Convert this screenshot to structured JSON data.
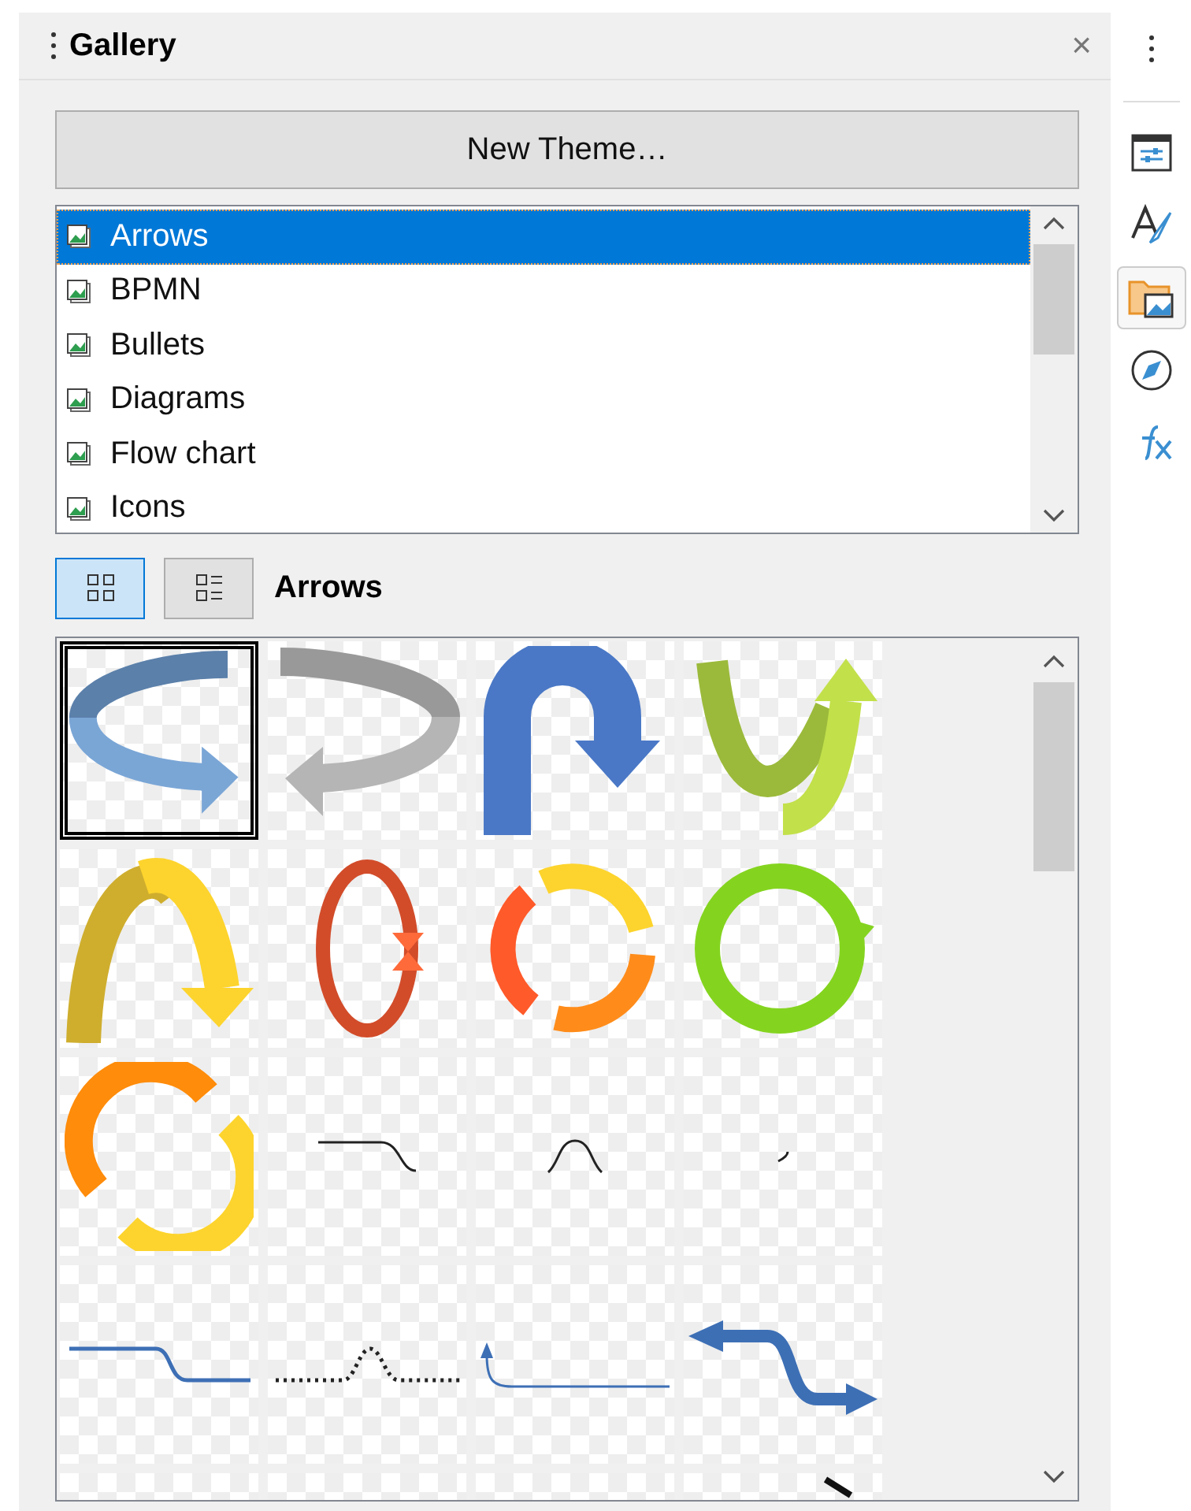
{
  "panel": {
    "title": "Gallery",
    "close": "×"
  },
  "new_theme_button": "New Theme…",
  "themes": [
    {
      "label": "Arrows",
      "selected": true
    },
    {
      "label": "BPMN",
      "selected": false
    },
    {
      "label": "Bullets",
      "selected": false
    },
    {
      "label": "Diagrams",
      "selected": false
    },
    {
      "label": "Flow chart",
      "selected": false
    },
    {
      "label": "Icons",
      "selected": false
    }
  ],
  "view_buttons": [
    {
      "kind": "icons",
      "selected": true
    },
    {
      "kind": "details",
      "selected": false
    }
  ],
  "current_theme": "Arrows",
  "items": [
    {
      "kind": "loop-blue",
      "selected": true
    },
    {
      "kind": "loop-grey",
      "selected": false
    },
    {
      "kind": "uturn",
      "selected": false
    },
    {
      "kind": "u-green",
      "selected": false
    },
    {
      "kind": "arch",
      "selected": false
    },
    {
      "kind": "oval",
      "selected": false
    },
    {
      "kind": "cycle-three",
      "selected": false
    },
    {
      "kind": "ring",
      "selected": false
    },
    {
      "kind": "cycle-two",
      "selected": false
    },
    {
      "kind": "step-line",
      "selected": false
    },
    {
      "kind": "bump-line",
      "selected": false
    },
    {
      "kind": "tiny-curve",
      "selected": false
    },
    {
      "kind": "step-blue",
      "selected": false
    },
    {
      "kind": "dotted-bump",
      "selected": false
    },
    {
      "kind": "corner-arrow",
      "selected": false
    },
    {
      "kind": "zigzag-arrow",
      "selected": false
    },
    {
      "kind": "empty",
      "selected": false
    },
    {
      "kind": "empty",
      "selected": false
    },
    {
      "kind": "empty",
      "selected": false
    },
    {
      "kind": "stroke",
      "selected": false
    }
  ],
  "sidebar_tabs": [
    {
      "kind": "properties",
      "selected": false
    },
    {
      "kind": "styles",
      "selected": false
    },
    {
      "kind": "gallery",
      "selected": true
    },
    {
      "kind": "navigator",
      "selected": false
    },
    {
      "kind": "functions",
      "selected": false
    }
  ]
}
